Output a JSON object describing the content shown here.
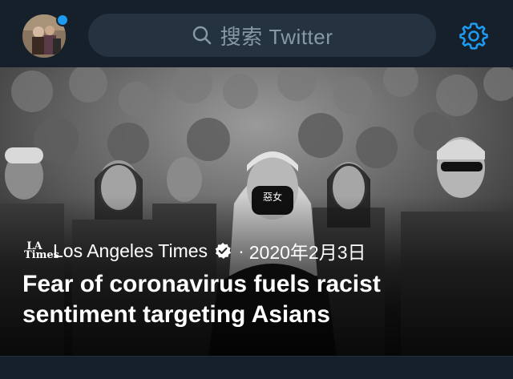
{
  "search": {
    "placeholder": "搜索 Twitter"
  },
  "news": {
    "source": "Los Angeles Times",
    "logo_text": "LA Times",
    "separator": "·",
    "date": "2020年2月3日",
    "headline": "Fear of coronavirus fuels racist sentiment targeting Asians"
  },
  "colors": {
    "accent": "#1d9bf0",
    "background": "#15202b",
    "search_bg": "#253341",
    "placeholder": "#8899a6"
  },
  "icons": {
    "search": "search-icon",
    "settings": "gear-icon",
    "verified": "verified-badge-icon",
    "notification": "notification-dot-icon"
  }
}
